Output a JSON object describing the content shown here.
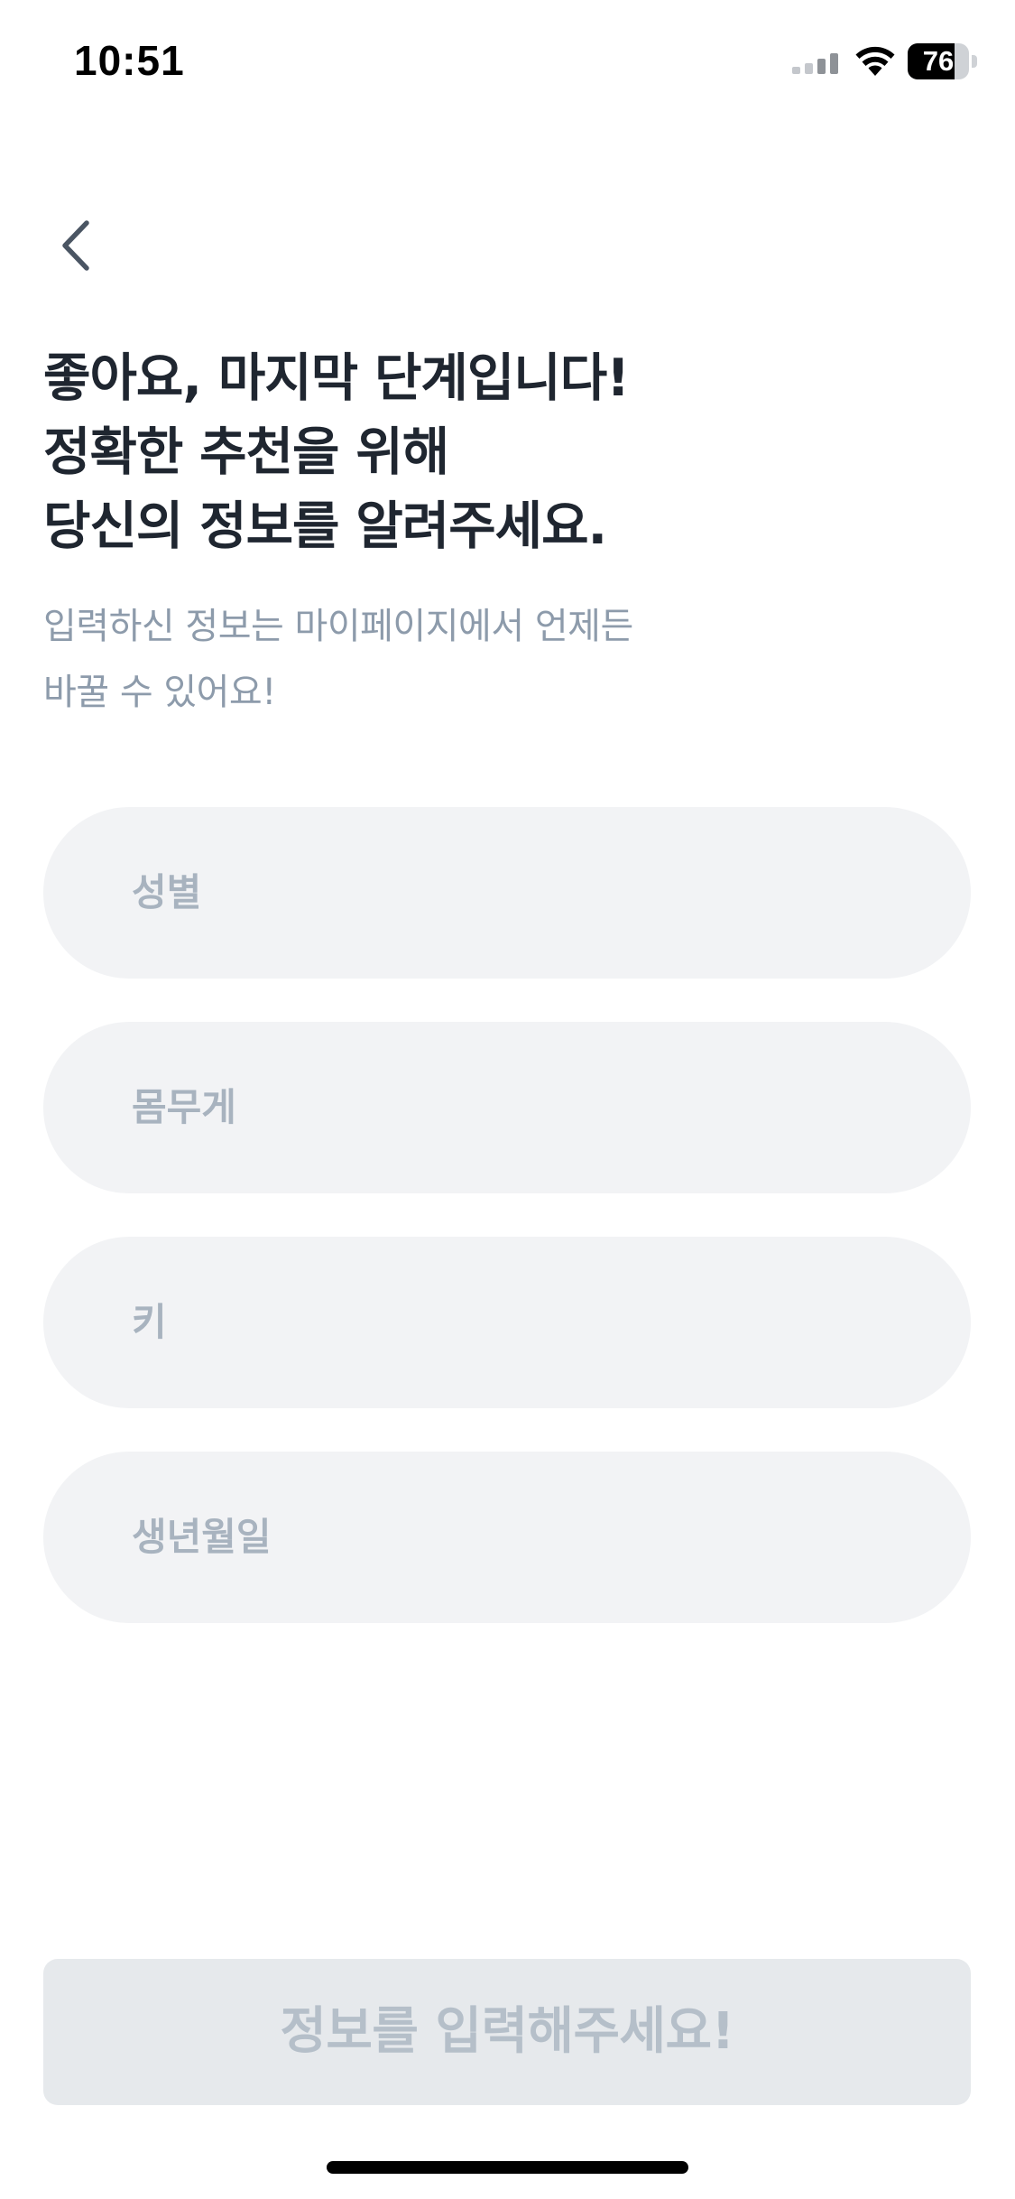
{
  "status_bar": {
    "time": "10:51",
    "battery_percent": "76",
    "battery_level": 0.76,
    "icons": [
      "signal-icon",
      "wifi-icon",
      "battery-icon"
    ]
  },
  "nav": {
    "back_icon": "chevron-left-icon"
  },
  "heading": {
    "line1": "좋아요, 마지막 단계입니다!",
    "line2": "정확한 추천을 위해",
    "line3": "당신의 정보를 알려주세요."
  },
  "subtext": {
    "line1": "입력하신 정보는 마이페이지에서 언제든",
    "line2": "바꿀 수 있어요!"
  },
  "form": {
    "gender_placeholder": "성별",
    "weight_placeholder": "몸무게",
    "height_placeholder": "키",
    "birthdate_placeholder": "생년월일"
  },
  "submit": {
    "label": "정보를 입력해주세요!",
    "enabled": false
  },
  "colors": {
    "heading": "#1f2630",
    "subtext": "#8d9bab",
    "field_bg": "#f2f3f5",
    "placeholder": "#a8b3bf",
    "button_bg_disabled": "#e6e9ec",
    "button_text_disabled": "#b5bfc9"
  }
}
